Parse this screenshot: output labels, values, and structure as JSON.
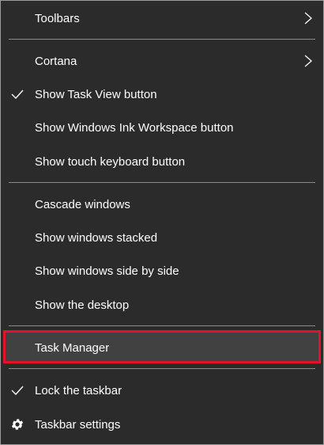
{
  "menu": {
    "items": [
      {
        "label": "Toolbars",
        "submenu": true
      },
      {
        "label": "Cortana",
        "submenu": true
      },
      {
        "label": "Show Task View button",
        "checked": true
      },
      {
        "label": "Show Windows Ink Workspace button"
      },
      {
        "label": "Show touch keyboard button"
      },
      {
        "label": "Cascade windows"
      },
      {
        "label": "Show windows stacked"
      },
      {
        "label": "Show windows side by side"
      },
      {
        "label": "Show the desktop"
      },
      {
        "label": "Task Manager",
        "highlighted": true,
        "highlight_color": "#e3122a"
      },
      {
        "label": "Lock the taskbar",
        "checked": true
      },
      {
        "label": "Taskbar settings",
        "icon": "gear-icon"
      }
    ]
  },
  "colors": {
    "background": "#2b2b2b",
    "text": "#ffffff",
    "separator": "#8a8a8a",
    "highlight_border": "#e3122a"
  }
}
